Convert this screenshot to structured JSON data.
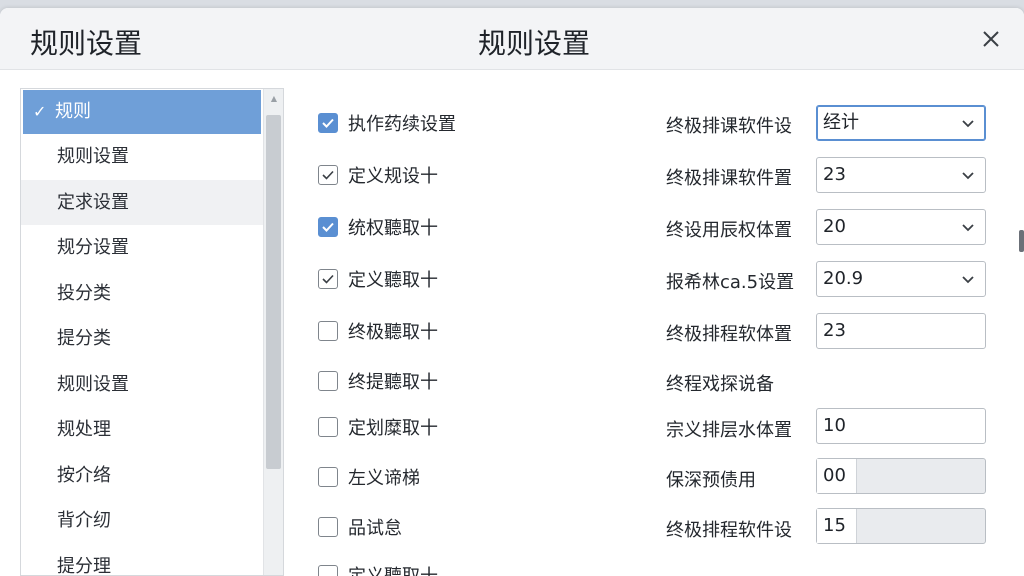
{
  "window": {
    "title_left": "规则设置",
    "title_center": "规则设置"
  },
  "sidebar": {
    "items": [
      {
        "label": "规则",
        "selected": true
      },
      {
        "label": "规则设置"
      },
      {
        "label": "定求设置"
      },
      {
        "label": "规分设置"
      },
      {
        "label": "投分类"
      },
      {
        "label": "提分类"
      },
      {
        "label": "规则设置"
      },
      {
        "label": "规处理"
      },
      {
        "label": "按介络"
      },
      {
        "label": "背介纫"
      },
      {
        "label": "提分理"
      }
    ]
  },
  "options": [
    {
      "label": "执作药续设置",
      "checked": true,
      "style": "blue"
    },
    {
      "label": "定义规设十",
      "checked": true,
      "style": "plain"
    },
    {
      "label": "统权聽取十",
      "checked": true,
      "style": "blue"
    },
    {
      "label": "定义聽取十",
      "checked": true,
      "style": "plain"
    },
    {
      "label": "终极聽取十",
      "checked": false
    },
    {
      "label": "终提聽取十",
      "checked": false
    },
    {
      "label": "定划糜取十",
      "checked": false
    },
    {
      "label": "左义谛梯",
      "checked": false
    },
    {
      "label": "品试怠",
      "checked": false
    },
    {
      "label": "定义聽取十",
      "checked": false
    }
  ],
  "fields": [
    {
      "label": "终极排课软件设",
      "type": "select",
      "value": "经计",
      "active": true
    },
    {
      "label": "终极排课软件置",
      "type": "select",
      "value": "23"
    },
    {
      "label": "终设用辰权体置",
      "type": "select",
      "value": "20"
    },
    {
      "label": "报希林ca.5设置",
      "type": "select",
      "value": "20.9"
    },
    {
      "label": "终极排程软体置",
      "type": "input",
      "value": "23"
    },
    {
      "label": "终程戏探说备",
      "type": "label"
    },
    {
      "label": "宗义排层水体置",
      "type": "input",
      "value": "10"
    },
    {
      "label": "保深预债用",
      "type": "split",
      "value": "00"
    },
    {
      "label": "终极排程软件设",
      "type": "split",
      "value": "15"
    }
  ],
  "colors": {
    "accent": "#5a8fd2",
    "selected_row": "#6f9fd8"
  },
  "icons": {
    "close": "close-icon",
    "check": "checkmark-icon",
    "dropdown": "chevron-down-icon"
  }
}
